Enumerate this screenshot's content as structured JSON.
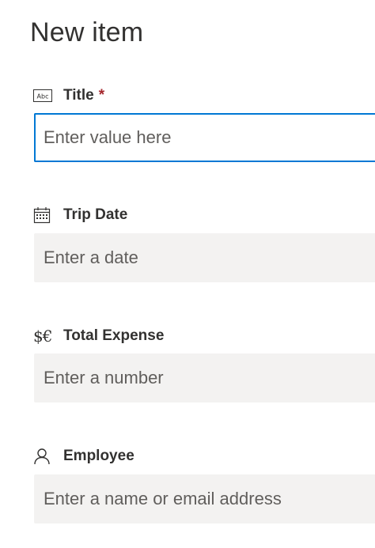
{
  "form": {
    "title": "New item",
    "fields": [
      {
        "label": "Title",
        "required_marker": "*",
        "icon": "text-field-icon",
        "icon_text": "Abc",
        "placeholder": "Enter value here",
        "value": "",
        "focused": true
      },
      {
        "label": "Trip Date",
        "icon": "calendar-icon",
        "placeholder": "Enter a date",
        "value": ""
      },
      {
        "label": "Total Expense",
        "icon": "currency-icon",
        "icon_text": "$€",
        "placeholder": "Enter a number",
        "value": ""
      },
      {
        "label": "Employee",
        "icon": "person-icon",
        "placeholder": "Enter a name or email address",
        "value": ""
      }
    ]
  },
  "colors": {
    "focus_border": "#0078d4",
    "field_background": "#f3f2f1",
    "required": "#a4262c",
    "text": "#323130",
    "placeholder": "#605e5c"
  }
}
